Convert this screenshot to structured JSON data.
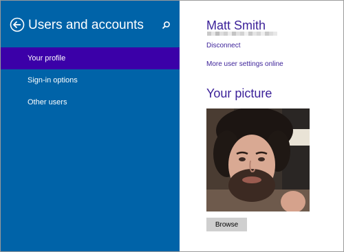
{
  "header": {
    "title": "Users and accounts",
    "back_icon": "back-arrow-circle-icon",
    "search_icon": "search-icon"
  },
  "nav": {
    "items": [
      {
        "label": "Your profile",
        "selected": true
      },
      {
        "label": "Sign-in options",
        "selected": false
      },
      {
        "label": "Other users",
        "selected": false
      }
    ]
  },
  "profile": {
    "name": "Matt Smith",
    "disconnect_label": "Disconnect",
    "more_settings_label": "More user settings online",
    "picture_title": "Your picture",
    "browse_label": "Browse"
  },
  "colors": {
    "left_pane": "#0063a8",
    "selected_item": "#3b00a8",
    "accent_text": "#3a1f98",
    "button_bg": "#cfcfcf"
  }
}
